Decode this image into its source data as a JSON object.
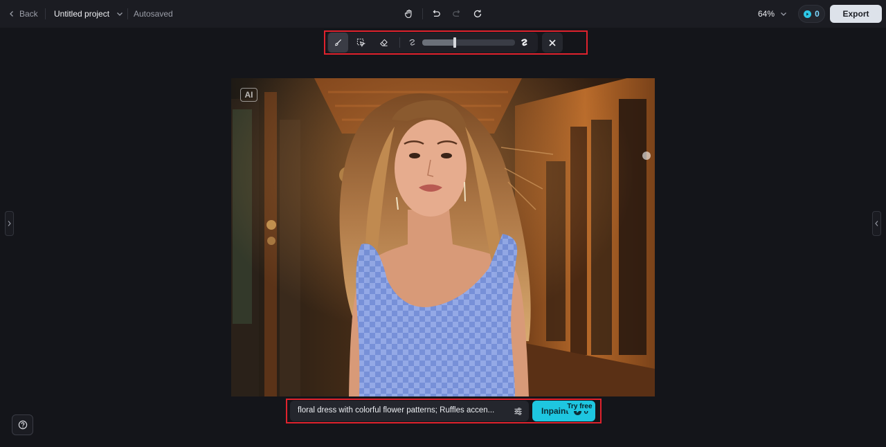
{
  "header": {
    "back_label": "Back",
    "project_title": "Untitled project",
    "save_status": "Autosaved",
    "zoom_level": "64%",
    "credits": "0",
    "export_label": "Export"
  },
  "toolbar": {
    "tools": [
      "brush-icon",
      "smart-select-icon",
      "eraser-icon"
    ],
    "active_tool": "brush",
    "brush_size_fraction": 0.35
  },
  "canvas": {
    "badge": "AI"
  },
  "prompt": {
    "text": "floral dress with colorful flower patterns; Ruffles accen...",
    "button_label": "Inpaint",
    "button_credits": "0",
    "tag": "Try free"
  },
  "colors": {
    "accent": "#1ec6e0",
    "highlight_frame": "#e0222d",
    "background": "#14151a"
  }
}
